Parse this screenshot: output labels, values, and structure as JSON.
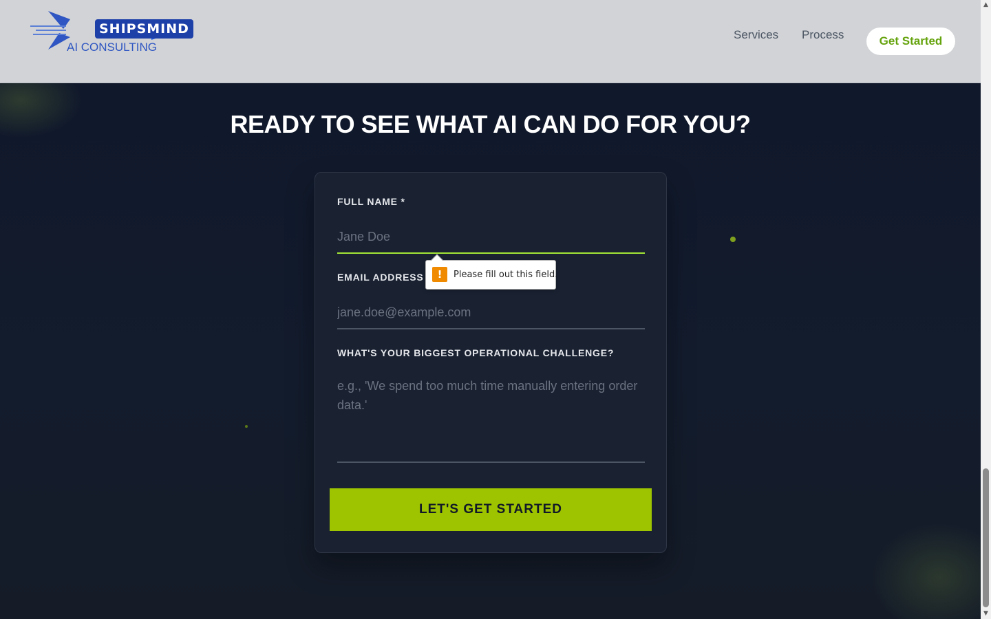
{
  "header": {
    "logo": {
      "name": "SHIPSMIND",
      "tagline": "AI CONSULTING"
    },
    "nav": [
      {
        "label": "Services"
      },
      {
        "label": "Process"
      }
    ],
    "cta_label": "Get Started"
  },
  "main": {
    "headline": "READY TO SEE WHAT AI CAN DO FOR YOU?",
    "form": {
      "full_name": {
        "label": "FULL NAME *",
        "placeholder": "Jane Doe",
        "value": ""
      },
      "email": {
        "label": "EMAIL ADDRESS *",
        "placeholder": "jane.doe@example.com",
        "value": ""
      },
      "challenge": {
        "label": "WHAT'S YOUR BIGGEST OPERATIONAL CHALLENGE?",
        "placeholder": "e.g., 'We spend too much time manually entering order data.'",
        "value": ""
      },
      "submit_label": "LET'S GET STARTED"
    }
  },
  "validation_tooltip": {
    "icon": "warning-icon",
    "message": "Please fill out this field."
  },
  "colors": {
    "accent": "#9ec400",
    "accent_text": "#65a30d",
    "background": "#111827",
    "header_bg": "#d1d3d6",
    "logo_blue": "#1d3fa8",
    "warning": "#f08a00"
  }
}
